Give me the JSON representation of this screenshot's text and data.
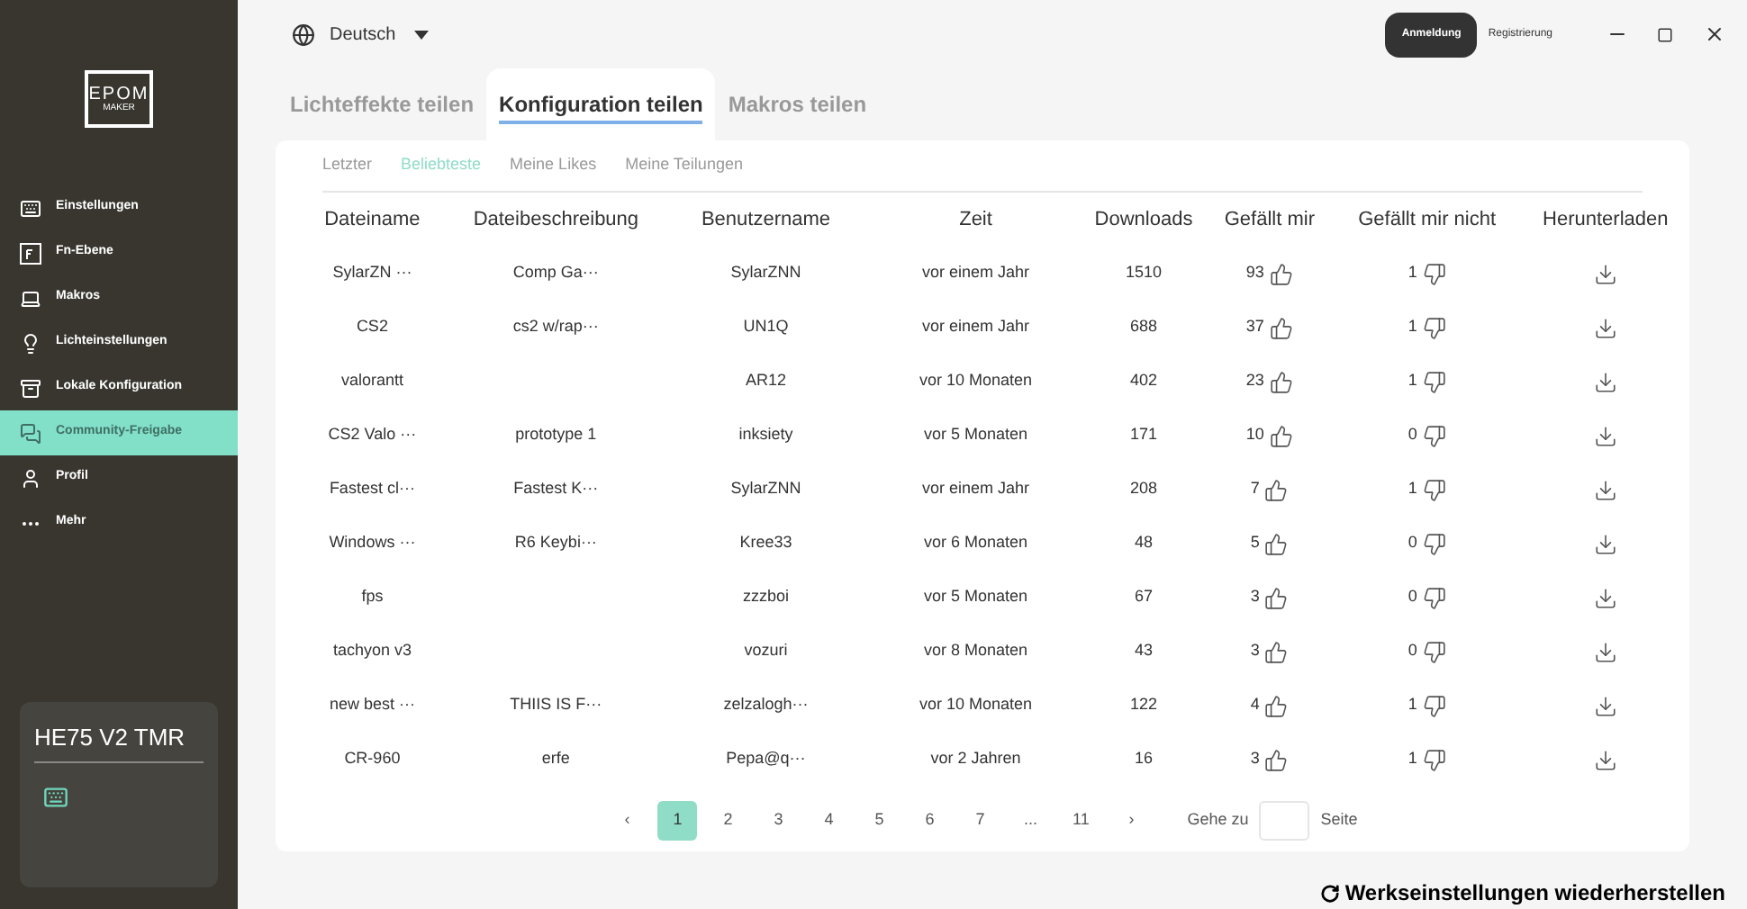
{
  "sidebar": {
    "logo": {
      "top": "EPOM",
      "bottom": "MAKER"
    },
    "items": [
      {
        "label": "Einstellungen",
        "selected": false
      },
      {
        "label": "Fn-Ebene",
        "selected": false
      },
      {
        "label": "Makros",
        "selected": false
      },
      {
        "label": "Lichteinstellungen",
        "selected": false
      },
      {
        "label": "Lokale Konfiguration",
        "selected": false
      },
      {
        "label": "Community-Freigabe",
        "selected": true
      },
      {
        "label": "Profil",
        "selected": false
      },
      {
        "label": "Mehr",
        "selected": false
      }
    ],
    "device": {
      "name": "HE75 V2 TMR"
    }
  },
  "topbar": {
    "language": "Deutsch",
    "login": "Anmeldung",
    "register": "Registrierung"
  },
  "tabs": [
    {
      "label": "Lichteffekte teilen",
      "selected": false
    },
    {
      "label": "Konfiguration teilen",
      "selected": true
    },
    {
      "label": "Makros teilen",
      "selected": false
    }
  ],
  "subtabs": [
    {
      "label": "Letzter",
      "selected": false
    },
    {
      "label": "Beliebteste",
      "selected": true
    },
    {
      "label": "Meine Likes",
      "selected": false
    },
    {
      "label": "Meine Teilungen",
      "selected": false
    }
  ],
  "table": {
    "columns": [
      "Dateiname",
      "Dateibeschreibung",
      "Benutzername",
      "Zeit",
      "Downloads",
      "Gefällt mir",
      "Gefällt mir nicht",
      "Herunterladen"
    ],
    "rows": [
      {
        "file": "SylarZN ···",
        "desc": "Comp Ga···",
        "user": "SylarZNN",
        "time": "vor einem Jahr",
        "downloads": "1510",
        "likes": "93",
        "dislikes": "1"
      },
      {
        "file": "CS2",
        "desc": "cs2 w/rap···",
        "user": "UN1Q",
        "time": "vor einem Jahr",
        "downloads": "688",
        "likes": "37",
        "dislikes": "1"
      },
      {
        "file": "valorantt",
        "user": "AR12",
        "time": "vor 10 Monaten",
        "downloads": "402",
        "likes": "23",
        "dislikes": "1"
      },
      {
        "file": "CS2 Valo ···",
        "desc": "prototype 1",
        "user": "inksiety",
        "time": "vor 5 Monaten",
        "downloads": "171",
        "likes": "10",
        "dislikes": "0"
      },
      {
        "file": "Fastest cl···",
        "desc": "Fastest K···",
        "user": "SylarZNN",
        "time": "vor einem Jahr",
        "downloads": "208",
        "likes": "7",
        "dislikes": "1"
      },
      {
        "file": "Windows ···",
        "desc": "R6 Keybi···",
        "user": "Kree33",
        "time": "vor 6 Monaten",
        "downloads": "48",
        "likes": "5",
        "dislikes": "0"
      },
      {
        "file": "fps",
        "user": "zzzboi",
        "time": "vor 5 Monaten",
        "downloads": "67",
        "likes": "3",
        "dislikes": "0"
      },
      {
        "file": "tachyon v3",
        "user": "vozuri",
        "time": "vor 8 Monaten",
        "downloads": "43",
        "likes": "3",
        "dislikes": "0"
      },
      {
        "file": "new best ···",
        "desc": "THIIS IS F···",
        "user": "zelzalogh···",
        "time": "vor 10 Monaten",
        "downloads": "122",
        "likes": "4",
        "dislikes": "1"
      },
      {
        "file": "CR-960",
        "desc": "erfe",
        "user": "Pepa@q···",
        "time": "vor 2 Jahren",
        "downloads": "16",
        "likes": "3",
        "dislikes": "1"
      }
    ]
  },
  "pagination": {
    "prev": "‹",
    "pages": [
      {
        "label": "1",
        "selected": true
      },
      {
        "label": "2",
        "selected": false
      },
      {
        "label": "3",
        "selected": false
      },
      {
        "label": "4",
        "selected": false
      },
      {
        "label": "5",
        "selected": false
      },
      {
        "label": "6",
        "selected": false
      },
      {
        "label": "7",
        "selected": false
      },
      {
        "label": "...",
        "selected": false
      },
      {
        "label": "11",
        "selected": false
      }
    ],
    "next": "›",
    "goto": "Gehe zu",
    "page_suffix": "Seite"
  },
  "reset": "Werkseinstellungen wiederherstellen"
}
